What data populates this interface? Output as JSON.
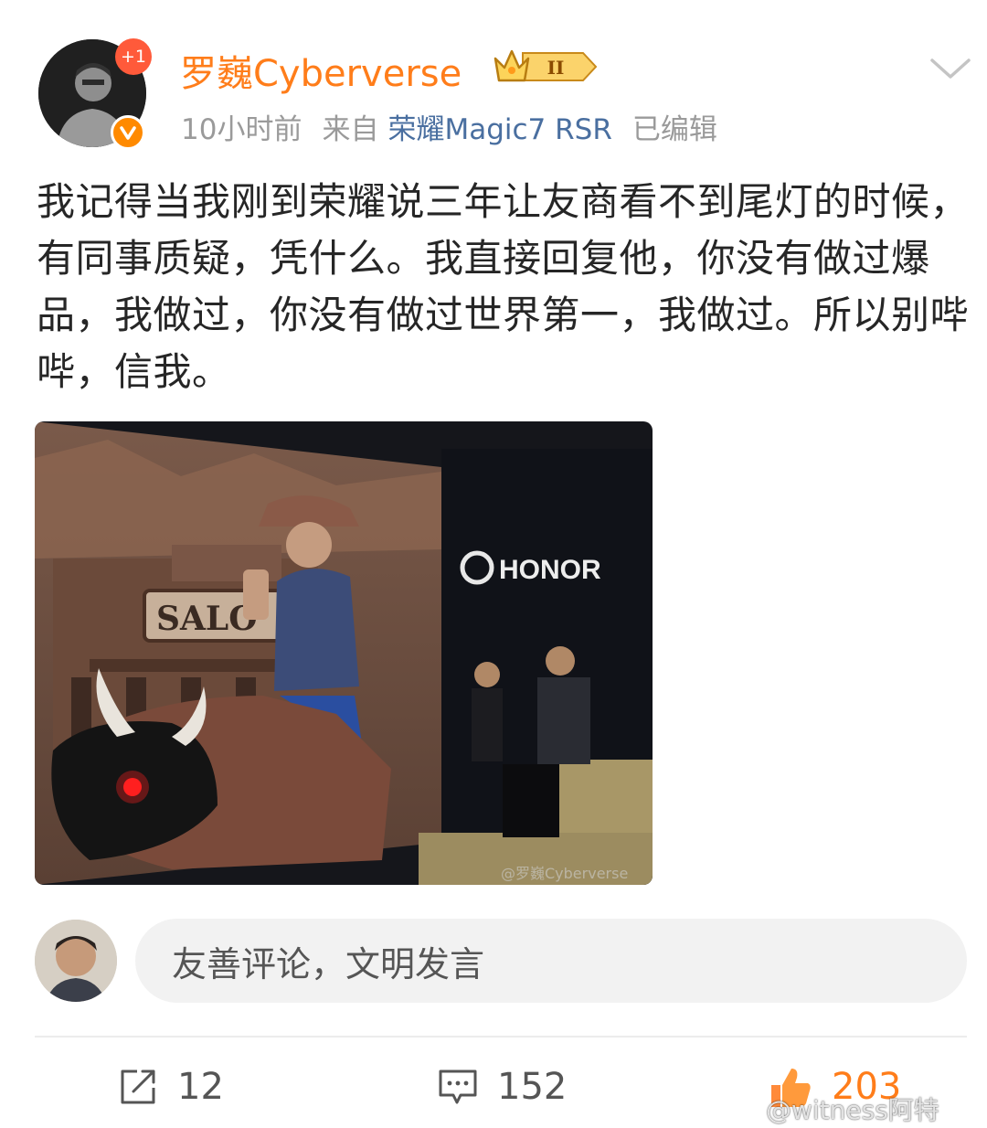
{
  "post": {
    "author": {
      "name": "罗巍Cyberverse",
      "follow_badge": "+1",
      "vip_level": "II"
    },
    "meta": {
      "time": "10小时前",
      "from_label": "来自",
      "source": "荣耀Magic7 RSR",
      "edited": "已编辑"
    },
    "text": "我记得当我刚到荣耀说三年让友商看不到尾灯的时候，有同事质疑，凭什么。我直接回复他，你没有做过爆品，我做过，你没有做过世界第一，我做过。所以别哔哔，信我。",
    "image": {
      "sign_text": "SALO",
      "brand_text": "HONOR",
      "watermark": "@罗巍Cyberverse"
    }
  },
  "comment_input": {
    "placeholder": "友善评论，文明发言"
  },
  "actions": {
    "repost_count": "12",
    "comment_count": "152",
    "like_count": "203"
  },
  "watermark": "@witness阿特",
  "colors": {
    "username": "#ff7d1a",
    "source_link": "#4a6fa0",
    "like_count": "#ff7d1a",
    "follow_badge": "#ff5a3a",
    "verify_badge": "#ff8a00"
  },
  "icons": {
    "more": "chevron-down-icon",
    "repost": "share-icon",
    "comment": "comment-icon",
    "like": "thumbs-up-icon",
    "verified": "verified-v-icon",
    "vip": "crown-icon"
  }
}
